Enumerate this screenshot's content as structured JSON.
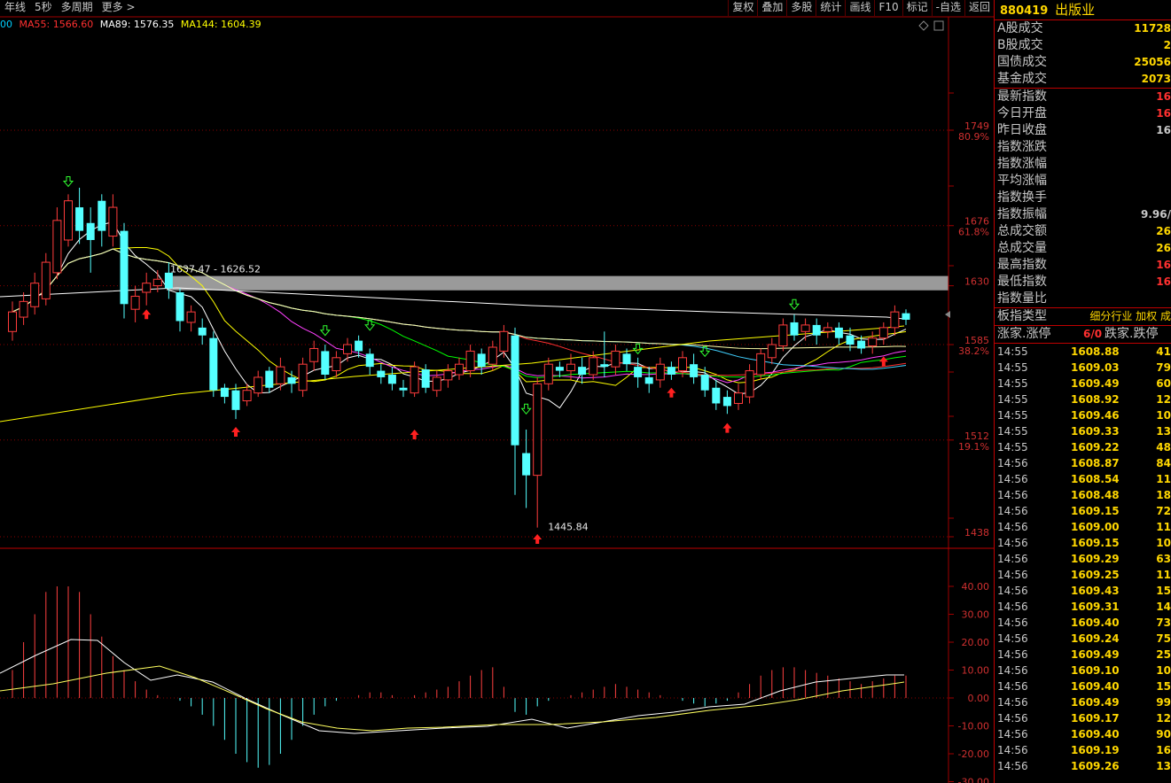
{
  "toolbar_left": [
    "年线",
    "5秒",
    "多周期",
    "更多 >"
  ],
  "toolbar_right": [
    "复权",
    "叠加",
    "多股",
    "统计",
    "画线",
    "F10",
    "标记",
    "-自选",
    "返回"
  ],
  "ma_legend": [
    {
      "text": "00",
      "color": "#00d0ff"
    },
    {
      "text": "MA55: 1566.60",
      "color": "#ff3030"
    },
    {
      "text": "MA89: 1576.35",
      "color": "#ffffff"
    },
    {
      "text": "MA144: 1604.39",
      "color": "#ffff00"
    }
  ],
  "price_axis": {
    "labels": [
      {
        "price": 1749,
        "label": "1749",
        "pct": "80.9%"
      },
      {
        "price": 1676,
        "label": "1676",
        "pct": "61.8%"
      },
      {
        "price": 1630,
        "label": "1630",
        "pct": ""
      },
      {
        "price": 1585,
        "label": "1585",
        "pct": "38.2%"
      },
      {
        "price": 1512,
        "label": "1512",
        "pct": "19.1%"
      },
      {
        "price": 1438,
        "label": "1438",
        "pct": ""
      }
    ]
  },
  "annotations": {
    "range_label": "1637.47 - 1626.52",
    "range_high": 1637.47,
    "range_low": 1626.52,
    "low_label": "1445.84",
    "low_price": 1445.84
  },
  "macd_axis": [
    "40.00",
    "30.00",
    "20.00",
    "10.00",
    "0.00",
    "-10.00",
    "-20.00",
    "-30.00"
  ],
  "chart_data": {
    "type": "candlestick",
    "ylim": [
      1438,
      1749
    ],
    "candles": [
      [
        1595,
        1610,
        1588,
        1618
      ],
      [
        1606,
        1618,
        1600,
        1625
      ],
      [
        1614,
        1632,
        1608,
        1640
      ],
      [
        1620,
        1648,
        1615,
        1655
      ],
      [
        1640,
        1680,
        1635,
        1690
      ],
      [
        1665,
        1695,
        1660,
        1700
      ],
      [
        1690,
        1672,
        1662,
        1705
      ],
      [
        1678,
        1665,
        1640,
        1690
      ],
      [
        1695,
        1672,
        1660,
        1700
      ],
      [
        1668,
        1690,
        1660,
        1700
      ],
      [
        1672,
        1616,
        1605,
        1678
      ],
      [
        1612,
        1622,
        1602,
        1630
      ],
      [
        1625,
        1632,
        1615,
        1640
      ],
      [
        1630,
        1635,
        1625,
        1642
      ],
      [
        1640,
        1628,
        1620,
        1648
      ],
      [
        1625,
        1603,
        1595,
        1628
      ],
      [
        1602,
        1610,
        1595,
        1615
      ],
      [
        1598,
        1592,
        1585,
        1605
      ],
      [
        1590,
        1550,
        1545,
        1595
      ],
      [
        1552,
        1545,
        1540,
        1555
      ],
      [
        1550,
        1535,
        1528,
        1555
      ],
      [
        1542,
        1550,
        1538,
        1555
      ],
      [
        1548,
        1560,
        1545,
        1565
      ],
      [
        1565,
        1552,
        1548,
        1568
      ],
      [
        1555,
        1568,
        1550,
        1575
      ],
      [
        1560,
        1555,
        1548,
        1565
      ],
      [
        1550,
        1570,
        1545,
        1575
      ],
      [
        1572,
        1582,
        1565,
        1588
      ],
      [
        1580,
        1562,
        1558,
        1585
      ],
      [
        1565,
        1575,
        1560,
        1580
      ],
      [
        1578,
        1585,
        1572,
        1590
      ],
      [
        1588,
        1580,
        1575,
        1592
      ],
      [
        1578,
        1568,
        1562,
        1582
      ],
      [
        1565,
        1560,
        1555,
        1570
      ],
      [
        1562,
        1555,
        1550,
        1568
      ],
      [
        1552,
        1550,
        1545,
        1558
      ],
      [
        1548,
        1568,
        1545,
        1572
      ],
      [
        1566,
        1552,
        1548,
        1570
      ],
      [
        1550,
        1560,
        1545,
        1565
      ],
      [
        1558,
        1565,
        1552,
        1570
      ],
      [
        1562,
        1570,
        1558,
        1575
      ],
      [
        1565,
        1580,
        1560,
        1585
      ],
      [
        1578,
        1568,
        1562,
        1582
      ],
      [
        1570,
        1583,
        1565,
        1588
      ],
      [
        1580,
        1595,
        1575,
        1600
      ],
      [
        1592,
        1508,
        1470,
        1598
      ],
      [
        1502,
        1485,
        1460,
        1520
      ],
      [
        1485,
        1555,
        1445,
        1560
      ],
      [
        1555,
        1570,
        1550,
        1575
      ],
      [
        1568,
        1565,
        1560,
        1572
      ],
      [
        1565,
        1570,
        1558,
        1578
      ],
      [
        1568,
        1562,
        1555,
        1575
      ],
      [
        1562,
        1575,
        1558,
        1580
      ],
      [
        1570,
        1568,
        1560,
        1595
      ],
      [
        1568,
        1580,
        1562,
        1585
      ],
      [
        1578,
        1570,
        1565,
        1582
      ],
      [
        1568,
        1560,
        1552,
        1575
      ],
      [
        1560,
        1555,
        1548,
        1568
      ],
      [
        1558,
        1570,
        1552,
        1575
      ],
      [
        1568,
        1562,
        1558,
        1572
      ],
      [
        1565,
        1575,
        1560,
        1580
      ],
      [
        1570,
        1560,
        1555,
        1578
      ],
      [
        1562,
        1550,
        1545,
        1568
      ],
      [
        1552,
        1540,
        1535,
        1558
      ],
      [
        1545,
        1538,
        1532,
        1550
      ],
      [
        1540,
        1548,
        1535,
        1555
      ],
      [
        1545,
        1565,
        1540,
        1570
      ],
      [
        1562,
        1578,
        1558,
        1582
      ],
      [
        1575,
        1585,
        1570,
        1590
      ],
      [
        1584,
        1600,
        1580,
        1605
      ],
      [
        1602,
        1592,
        1588,
        1608
      ],
      [
        1595,
        1600,
        1588,
        1605
      ],
      [
        1600,
        1592,
        1585,
        1605
      ],
      [
        1595,
        1598,
        1590,
        1602
      ],
      [
        1598,
        1590,
        1585,
        1602
      ],
      [
        1592,
        1585,
        1580,
        1598
      ],
      [
        1588,
        1582,
        1578,
        1592
      ],
      [
        1584,
        1590,
        1578,
        1595
      ],
      [
        1590,
        1598,
        1585,
        1602
      ],
      [
        1598,
        1610,
        1592,
        1615
      ],
      [
        1609,
        1604,
        1600,
        1612
      ]
    ],
    "ma_series": [
      {
        "name": "MA55",
        "color": "#ff3030"
      },
      {
        "name": "MA89",
        "color": "#ffffff"
      },
      {
        "name": "MA144",
        "color": "#ffff00"
      }
    ]
  },
  "sidebar": {
    "code": "880419",
    "name": "出版业",
    "volume_rows": [
      {
        "label": "A股成交",
        "value": "11728"
      },
      {
        "label": "B股成交",
        "value": "2"
      },
      {
        "label": "国债成交",
        "value": "25056"
      },
      {
        "label": "基金成交",
        "value": "2073"
      }
    ],
    "index_rows": [
      {
        "label": "最新指数",
        "value": "16",
        "color": "#ff3030"
      },
      {
        "label": "今日开盘",
        "value": "16",
        "color": "#ff3030"
      },
      {
        "label": "昨日收盘",
        "value": "16",
        "color": "#c8c8c8"
      },
      {
        "label": "指数涨跌",
        "value": "",
        "color": "#ff3030"
      },
      {
        "label": "指数涨幅",
        "value": "",
        "color": "#ff3030"
      },
      {
        "label": "平均涨幅",
        "value": "",
        "color": "#ff3030"
      },
      {
        "label": "指数换手",
        "value": "",
        "color": "#c8c8c8"
      },
      {
        "label": "指数振幅",
        "value": "9.96/",
        "color": "#c8c8c8"
      },
      {
        "label": "总成交额",
        "value": "26",
        "color": "#ffd700"
      },
      {
        "label": "总成交量",
        "value": "26",
        "color": "#ffd700"
      },
      {
        "label": "最高指数",
        "value": "16",
        "color": "#ff3030"
      },
      {
        "label": "最低指数",
        "value": "16",
        "color": "#ff3030"
      },
      {
        "label": "指数量比",
        "value": "",
        "color": "#c8c8c8"
      }
    ],
    "type_row": {
      "label": "板指类型",
      "value": "细分行业 加权 成",
      "color": "#ffd700"
    },
    "limit_row": {
      "label": "涨家.涨停",
      "value": "6/0",
      "label2": "跌家.跌停"
    },
    "ticks": [
      {
        "t": "14:55",
        "p": "1608.88",
        "v": "41"
      },
      {
        "t": "14:55",
        "p": "1609.03",
        "v": "79"
      },
      {
        "t": "14:55",
        "p": "1609.49",
        "v": "60"
      },
      {
        "t": "14:55",
        "p": "1608.92",
        "v": "12"
      },
      {
        "t": "14:55",
        "p": "1609.46",
        "v": "10"
      },
      {
        "t": "14:55",
        "p": "1609.33",
        "v": "13"
      },
      {
        "t": "14:55",
        "p": "1609.22",
        "v": "48"
      },
      {
        "t": "14:56",
        "p": "1608.87",
        "v": "84"
      },
      {
        "t": "14:56",
        "p": "1608.54",
        "v": "11"
      },
      {
        "t": "14:56",
        "p": "1608.48",
        "v": "18"
      },
      {
        "t": "14:56",
        "p": "1609.15",
        "v": "72"
      },
      {
        "t": "14:56",
        "p": "1609.00",
        "v": "11"
      },
      {
        "t": "14:56",
        "p": "1609.15",
        "v": "10"
      },
      {
        "t": "14:56",
        "p": "1609.29",
        "v": "63"
      },
      {
        "t": "14:56",
        "p": "1609.25",
        "v": "11"
      },
      {
        "t": "14:56",
        "p": "1609.43",
        "v": "15"
      },
      {
        "t": "14:56",
        "p": "1609.31",
        "v": "14"
      },
      {
        "t": "14:56",
        "p": "1609.40",
        "v": "73"
      },
      {
        "t": "14:56",
        "p": "1609.24",
        "v": "75"
      },
      {
        "t": "14:56",
        "p": "1609.49",
        "v": "25"
      },
      {
        "t": "14:56",
        "p": "1609.10",
        "v": "10"
      },
      {
        "t": "14:56",
        "p": "1609.40",
        "v": "15"
      },
      {
        "t": "14:56",
        "p": "1609.49",
        "v": "99"
      },
      {
        "t": "14:56",
        "p": "1609.17",
        "v": "12"
      },
      {
        "t": "14:56",
        "p": "1609.40",
        "v": "90"
      },
      {
        "t": "14:56",
        "p": "1609.19",
        "v": "16"
      },
      {
        "t": "14:56",
        "p": "1609.26",
        "v": "13"
      }
    ]
  }
}
